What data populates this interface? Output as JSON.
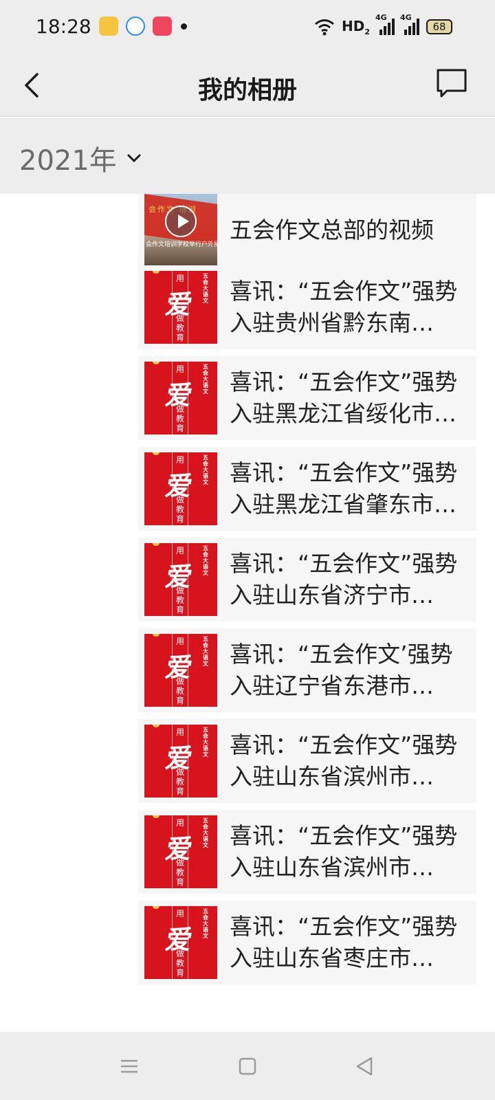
{
  "status_bar": {
    "time": "18:28",
    "network_label": "HD",
    "network_sub": "2",
    "signal_1_label": "4G",
    "signal_2_label": "4G",
    "battery": "68"
  },
  "header": {
    "title": "我的相册",
    "back_icon": "chevron-left-icon",
    "action_icon": "comment-icon"
  },
  "year_filter": {
    "label": "2021年"
  },
  "thumbnail_text": {
    "char_top": "用",
    "char_main": "爱",
    "char_bottom": "做教育",
    "side_text": "五会大语文",
    "video_flag": "会作文 培训",
    "video_caption": "会作文培训学校举行户外拓展"
  },
  "posts": [
    {
      "type": "video",
      "title": "五会作文总部的视频"
    },
    {
      "type": "article",
      "title": "喜讯：“五会作文”强势入驻贵州省黔东南…"
    },
    {
      "type": "article",
      "title": "喜讯：“五会作文”强势入驻黑龙江省绥化市…"
    },
    {
      "type": "article",
      "title": "喜讯：“五会作文”强势入驻黑龙江省肇东市…"
    },
    {
      "type": "article",
      "title": "喜讯：“五会作文”强势入驻山东省济宁市…"
    },
    {
      "type": "article",
      "title": "喜讯：“五会作文’强势入驻辽宁省东港市…"
    },
    {
      "type": "article",
      "title": "喜讯：“五会作文”强势入驻山东省滨州市…"
    },
    {
      "type": "article",
      "title": "喜讯：“五会作文”强势入驻山东省滨州市…"
    },
    {
      "type": "article",
      "title": "喜讯：“五会作文”强势入驻山东省枣庄市…"
    }
  ],
  "colors": {
    "bar_background": "#ededed",
    "item_background": "#f6f6f6",
    "thumbnail_red": "#d7141d"
  }
}
